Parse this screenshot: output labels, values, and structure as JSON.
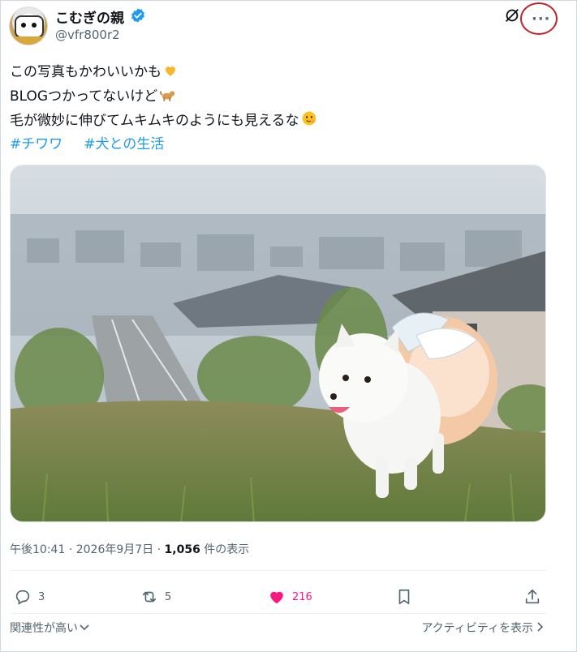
{
  "author": {
    "display_name": "こむぎの親",
    "handle": "@vfr800r2"
  },
  "tweet": {
    "lines": [
      "この写真もかわいいかも",
      "BLOGつかってないけど",
      "毛が微妙に伸びてムキムキのようにも見えるな"
    ],
    "hashtags": [
      "#チワワ",
      "#犬との生活"
    ]
  },
  "meta": {
    "time": "午後10:41",
    "dot1": "·",
    "date": "2026年9月7日",
    "dot2": "·",
    "views": "1,056",
    "views_label": "件の表示"
  },
  "actions": {
    "replies": "3",
    "reposts": "5",
    "likes": "216"
  },
  "footer": {
    "relevance": "関連性が高い",
    "activity": "アクティビティを表示"
  },
  "colors": {
    "accent": "#1d9bf0",
    "like": "#f91880",
    "highlight_ring": "#c0242c"
  }
}
